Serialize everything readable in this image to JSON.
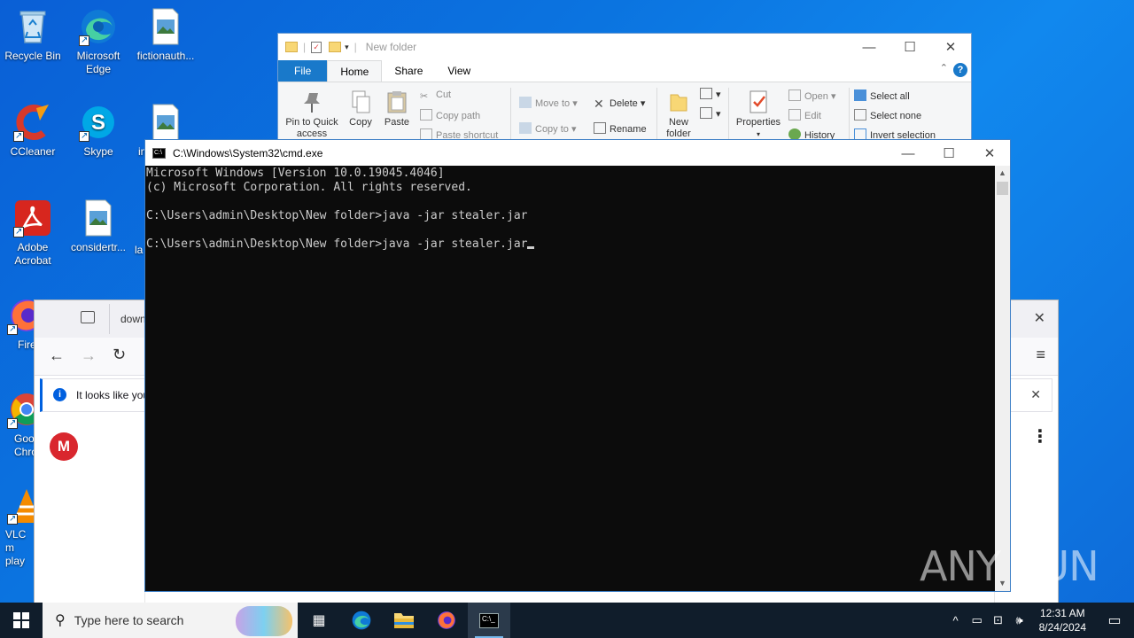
{
  "desktop": {
    "icons": [
      {
        "label": "Recycle Bin"
      },
      {
        "label": "Microsoft Edge"
      },
      {
        "label": "fictionauth..."
      },
      {
        "label": "CCleaner"
      },
      {
        "label": "Skype"
      },
      {
        "label": "Adobe Acrobat"
      },
      {
        "label": "considertr..."
      },
      {
        "label": "Fire"
      },
      {
        "label": "Goo Chro"
      },
      {
        "label": "VLC m play"
      }
    ],
    "partial_labels": [
      "in",
      "la"
    ]
  },
  "explorer": {
    "title": "New folder",
    "tabs": [
      "File",
      "Home",
      "Share",
      "View"
    ],
    "clipboard": {
      "pin": "Pin to Quick access",
      "copy": "Copy",
      "paste": "Paste",
      "cut": "Cut",
      "copy_path": "Copy path",
      "paste_shortcut": "Paste shortcut"
    },
    "organize": {
      "move_to": "Move to",
      "copy_to": "Copy to",
      "delete": "Delete",
      "rename": "Rename"
    },
    "new": {
      "new_folder": "New folder"
    },
    "open": {
      "properties": "Properties",
      "open": "Open",
      "edit": "Edit",
      "history": "History"
    },
    "select": {
      "select_all": "Select all",
      "select_none": "Select none",
      "invert": "Invert selection"
    }
  },
  "browser": {
    "tab_label": "down",
    "notice_text": "It looks like you",
    "content_logo": "M"
  },
  "cmd": {
    "title": "C:\\Windows\\System32\\cmd.exe",
    "lines": [
      "Microsoft Windows [Version 10.0.19045.4046]",
      "(c) Microsoft Corporation. All rights reserved.",
      "",
      "C:\\Users\\admin\\Desktop\\New folder>java -jar stealer.jar",
      "",
      "C:\\Users\\admin\\Desktop\\New folder>java -jar stealer.jar"
    ]
  },
  "watermark": "ANY RUN",
  "taskbar": {
    "search_placeholder": "Type here to search",
    "time": "12:31 AM",
    "date": "8/24/2024"
  }
}
